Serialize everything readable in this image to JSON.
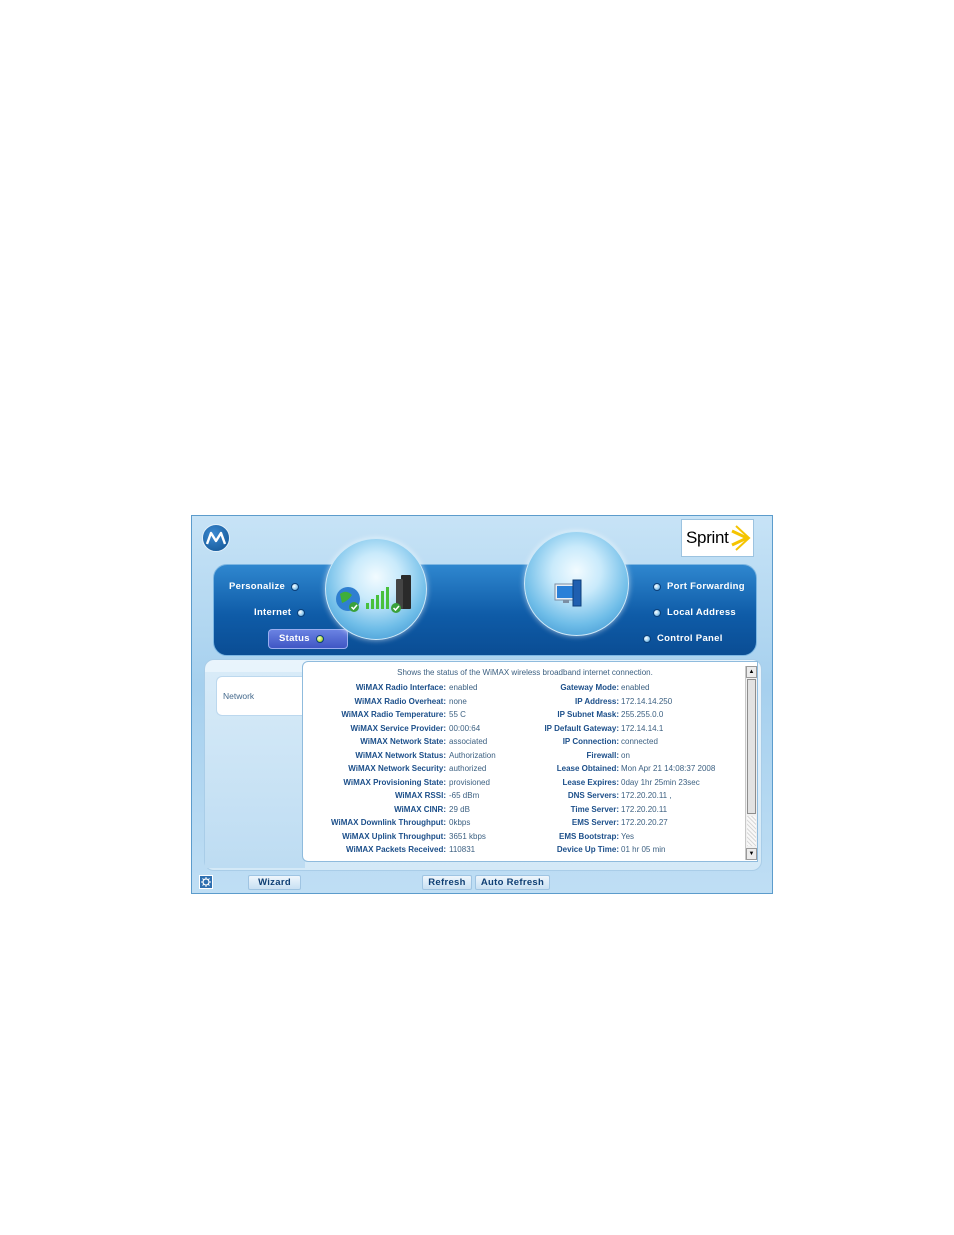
{
  "nav": {
    "left": [
      {
        "label": "Personalize"
      },
      {
        "label": "Internet"
      },
      {
        "label": "Status"
      }
    ],
    "right": [
      {
        "label": "Port Forwarding"
      },
      {
        "label": "Local Address"
      },
      {
        "label": "Control Panel"
      }
    ]
  },
  "logos": {
    "sprint_text": "Sprint"
  },
  "sidebar": {
    "tab_label": "Network"
  },
  "status": {
    "caption": "Shows the status of the WiMAX wireless broadband internet connection.",
    "left": [
      {
        "label": "WiMAX Radio Interface:",
        "value": "enabled"
      },
      {
        "label": "WiMAX Radio Overheat:",
        "value": "none"
      },
      {
        "label": "WiMAX Radio Temperature:",
        "value": "55 C"
      },
      {
        "label": "WiMAX Service Provider:",
        "value": "00:00:64"
      },
      {
        "label": "WiMAX Network State:",
        "value": "associated"
      },
      {
        "label": "WiMAX Network Status:",
        "value": "Authorization"
      },
      {
        "label": "WiMAX Network Security:",
        "value": "authorized"
      },
      {
        "label": "WiMAX Provisioning State:",
        "value": "provisioned"
      },
      {
        "label": "WiMAX RSSI:",
        "value": "-65 dBm"
      },
      {
        "label": "WiMAX CINR:",
        "value": "29 dB"
      },
      {
        "label": "WiMAX Downlink Throughput:",
        "value": "0kbps"
      },
      {
        "label": "WiMAX Uplink Throughput:",
        "value": "3651 kbps"
      },
      {
        "label": "WiMAX Packets Received:",
        "value": "110831"
      }
    ],
    "right": [
      {
        "label": "Gateway Mode:",
        "value": "enabled"
      },
      {
        "label": "IP Address:",
        "value": "172.14.14.250"
      },
      {
        "label": "IP Subnet Mask:",
        "value": "255.255.0.0"
      },
      {
        "label": "IP Default Gateway:",
        "value": "172.14.14.1"
      },
      {
        "label": "IP Connection:",
        "value": "connected"
      },
      {
        "label": "Firewall:",
        "value": "on"
      },
      {
        "label": "Lease Obtained:",
        "value": "Mon Apr 21 14:08:37 2008"
      },
      {
        "label": "Lease Expires:",
        "value": "0day 1hr 25min 23sec"
      },
      {
        "label": "DNS Servers:",
        "value": "172.20.20.11 ,"
      },
      {
        "label": "Time Server:",
        "value": "172.20.20.11"
      },
      {
        "label": "EMS Server:",
        "value": "172.20.20.27"
      },
      {
        "label": "EMS Bootstrap:",
        "value": "Yes"
      },
      {
        "label": "Device Up Time:",
        "value": "01 hr 05 min"
      }
    ]
  },
  "bottom": {
    "wizard_label": "Wizard",
    "refresh_label": "Refresh",
    "auto_refresh_label": "Auto Refresh"
  }
}
